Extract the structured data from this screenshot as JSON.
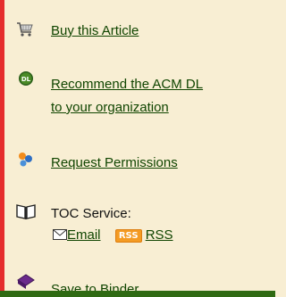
{
  "links": {
    "buy_article": "Buy this Article",
    "recommend_line1": "Recommend the ACM DL",
    "recommend_line2": "to your organization",
    "request_permissions": "Request Permissions",
    "save_to_binder": "Save to Binder"
  },
  "toc": {
    "label": "TOC Service:",
    "email": "Email",
    "rss_badge": "RSS",
    "rss": "RSS"
  },
  "icons": {
    "buy": "shopping-cart-icon",
    "recommend": "dl-badge-icon",
    "permissions": "permissions-icon",
    "toc": "open-book-icon",
    "email": "envelope-icon",
    "rss": "rss-badge-icon",
    "binder": "binder-icon"
  },
  "colors": {
    "link": "#104500",
    "background": "#f8eed3",
    "left_rule": "#e52d2d",
    "bottom_bar": "#2f6a13",
    "rss": "#f49b23"
  }
}
